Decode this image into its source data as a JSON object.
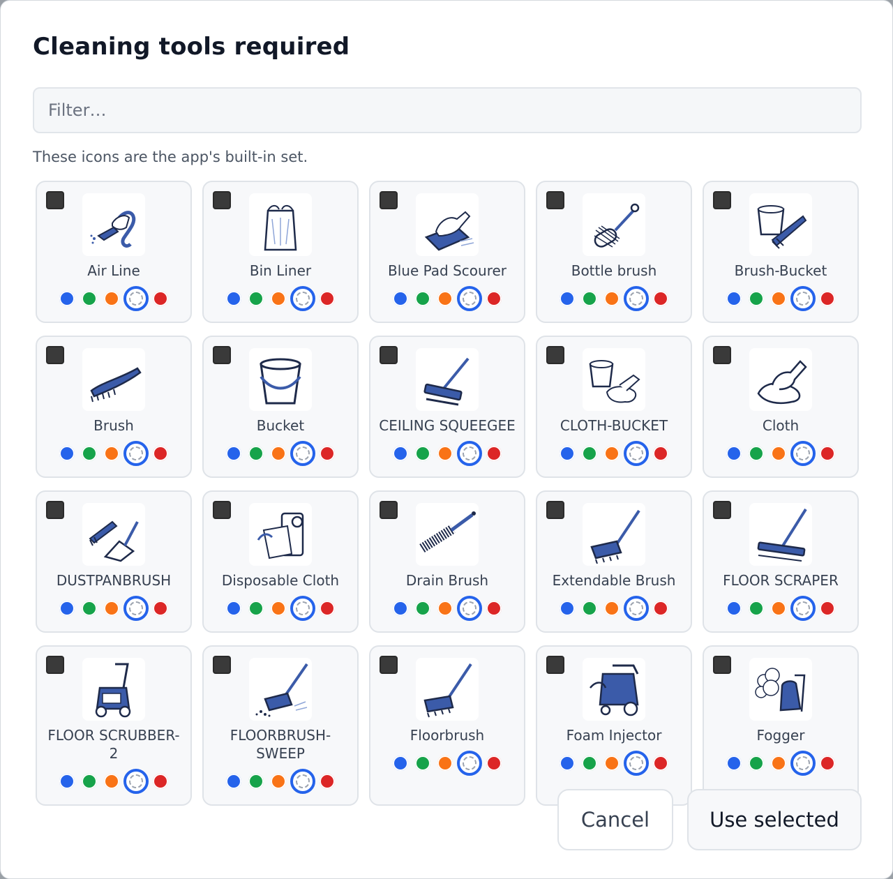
{
  "dialog": {
    "title": "Cleaning tools required",
    "filter_placeholder": "Filter…",
    "note": "These icons are the app's built-in set."
  },
  "swatch_colors": {
    "blue": "#2563eb",
    "green": "#16a34a",
    "orange": "#f97316",
    "none": "selected",
    "red": "#dc2626"
  },
  "tools": [
    {
      "label": "Air Line",
      "icon": "air-line-icon",
      "selected_color": "none",
      "checked": false
    },
    {
      "label": "Bin Liner",
      "icon": "bin-liner-icon",
      "selected_color": "none",
      "checked": false
    },
    {
      "label": "Blue Pad Scourer",
      "icon": "pad-scourer-icon",
      "selected_color": "none",
      "checked": false
    },
    {
      "label": "Bottle brush",
      "icon": "bottle-brush-icon",
      "selected_color": "none",
      "checked": false
    },
    {
      "label": "Brush-Bucket",
      "icon": "brush-bucket-icon",
      "selected_color": "none",
      "checked": false
    },
    {
      "label": "Brush",
      "icon": "hand-brush-icon",
      "selected_color": "none",
      "checked": false
    },
    {
      "label": "Bucket",
      "icon": "bucket-icon",
      "selected_color": "none",
      "checked": false
    },
    {
      "label": "CEILING SQUEEGEE",
      "icon": "squeegee-icon",
      "selected_color": "none",
      "checked": false
    },
    {
      "label": "CLOTH-BUCKET",
      "icon": "cloth-bucket-icon",
      "selected_color": "none",
      "checked": false
    },
    {
      "label": "Cloth",
      "icon": "cloth-icon",
      "selected_color": "none",
      "checked": false
    },
    {
      "label": "DUSTPANBRUSH",
      "icon": "dustpan-brush-icon",
      "selected_color": "none",
      "checked": false
    },
    {
      "label": "Disposable Cloth",
      "icon": "disposable-cloth-icon",
      "selected_color": "none",
      "checked": false
    },
    {
      "label": "Drain Brush",
      "icon": "drain-brush-icon",
      "selected_color": "none",
      "checked": false
    },
    {
      "label": "Extendable Brush",
      "icon": "extendable-brush-icon",
      "selected_color": "none",
      "checked": false
    },
    {
      "label": "FLOOR SCRAPER",
      "icon": "floor-scraper-icon",
      "selected_color": "none",
      "checked": false
    },
    {
      "label": "FLOOR SCRUBBER-2",
      "icon": "floor-scrubber-icon",
      "selected_color": "none",
      "checked": false
    },
    {
      "label": "FLOORBRUSH-SWEEP",
      "icon": "floorbrush-sweep-icon",
      "selected_color": "none",
      "checked": false
    },
    {
      "label": "Floorbrush",
      "icon": "floorbrush-icon",
      "selected_color": "none",
      "checked": false
    },
    {
      "label": "Foam Injector",
      "icon": "foam-injector-icon",
      "selected_color": "none",
      "checked": false
    },
    {
      "label": "Fogger",
      "icon": "fogger-icon",
      "selected_color": "none",
      "checked": false
    }
  ],
  "buttons": {
    "cancel": "Cancel",
    "use_selected": "Use selected"
  }
}
